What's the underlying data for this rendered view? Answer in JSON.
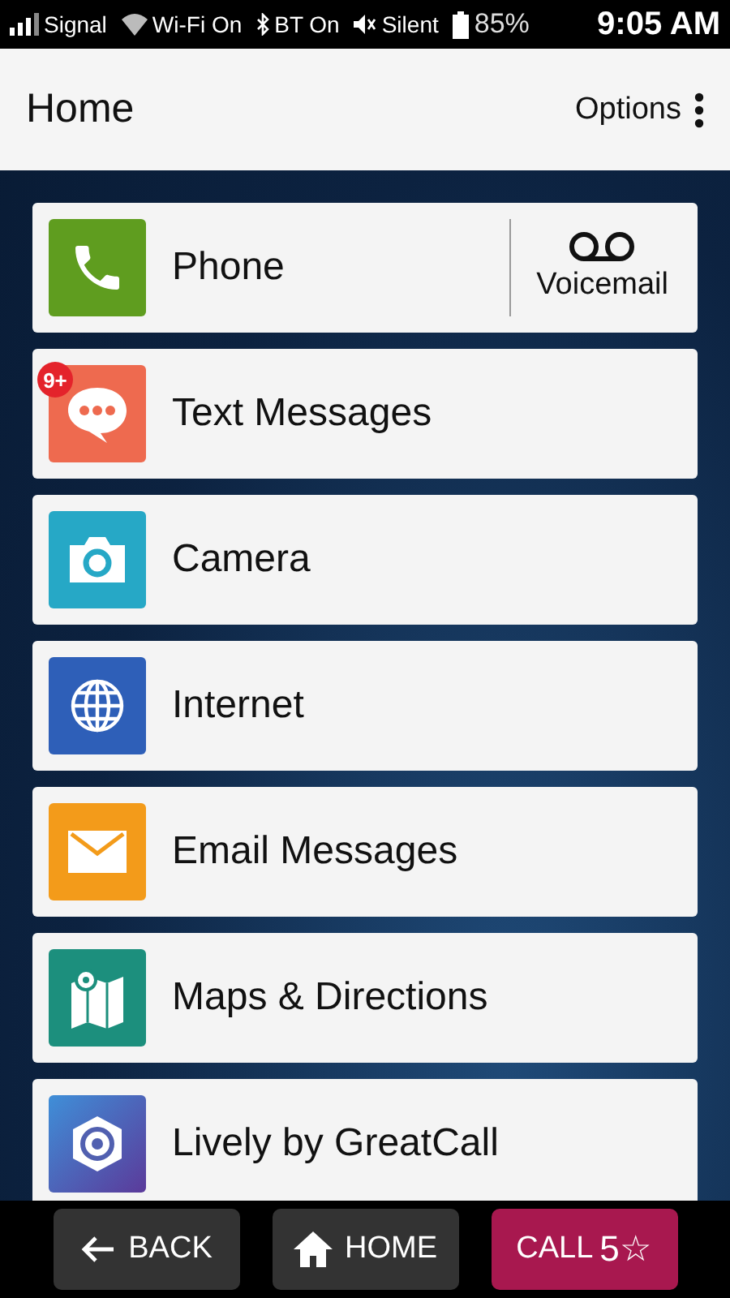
{
  "status_bar": {
    "signal": "Signal",
    "wifi": "Wi-Fi On",
    "bluetooth": "BT On",
    "sound": "Silent",
    "battery": "85%",
    "time": "9:05 AM"
  },
  "header": {
    "title": "Home",
    "options": "Options"
  },
  "apps": [
    {
      "kind": "phone",
      "label": "Phone",
      "action": "Voicemail"
    },
    {
      "kind": "messages",
      "label": "Text Messages",
      "badge": "9+"
    },
    {
      "kind": "camera",
      "label": "Camera"
    },
    {
      "kind": "internet",
      "label": "Internet"
    },
    {
      "kind": "email",
      "label": "Email Messages"
    },
    {
      "kind": "maps",
      "label": "Maps & Directions"
    },
    {
      "kind": "lively",
      "label": "Lively by GreatCall"
    }
  ],
  "nav": [
    {
      "kind": "back",
      "label": "BACK"
    },
    {
      "kind": "home",
      "label": "HOME"
    },
    {
      "kind": "call",
      "label": "CALL",
      "suffix": "5☆"
    }
  ]
}
